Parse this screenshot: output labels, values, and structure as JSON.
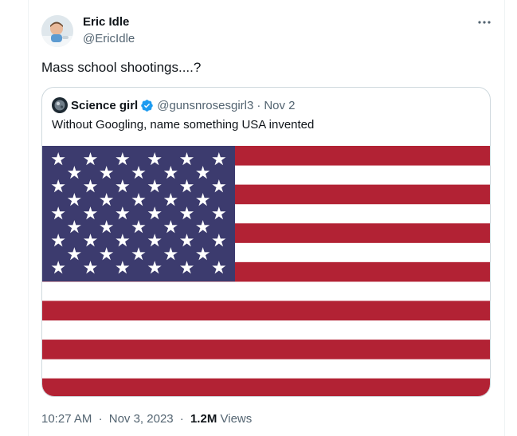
{
  "tweet": {
    "author": {
      "name": "Eric Idle",
      "handle": "@EricIdle"
    },
    "text": "Mass school shootings....?",
    "more_icon": "ellipsis-icon"
  },
  "quote": {
    "author": {
      "name": "Science girl",
      "handle": "@gunsnrosesgirl3",
      "verified": true
    },
    "separator": "·",
    "date": "Nov 2",
    "text": "Without Googling, name something USA invented",
    "media": "us-flag-image"
  },
  "meta": {
    "time": "10:27 AM",
    "separator": "·",
    "date": "Nov 3, 2023",
    "views_count": "1.2M",
    "views_label": "Views"
  },
  "colors": {
    "text": "#0f1419",
    "muted": "#536471",
    "border": "#cfd9de",
    "verified": "#1d9bf0",
    "flag_red": "#b22234",
    "flag_blue": "#3c3b6e"
  }
}
